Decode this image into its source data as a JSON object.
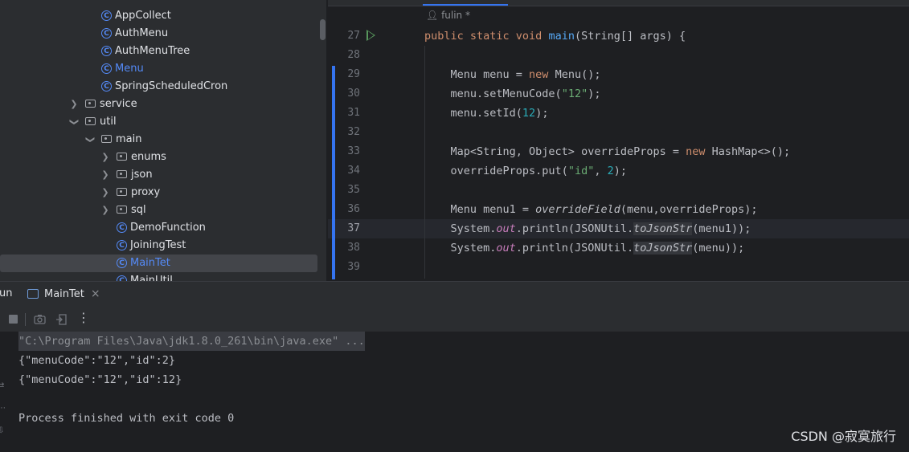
{
  "project_tree": {
    "items": [
      {
        "label": "AppCollect",
        "kind": "class"
      },
      {
        "label": "AuthMenu",
        "kind": "class"
      },
      {
        "label": "AuthMenuTree",
        "kind": "class"
      },
      {
        "label": "Menu",
        "kind": "class",
        "highlight": true
      },
      {
        "label": "SpringScheduledCron",
        "kind": "class"
      },
      {
        "label": "service",
        "kind": "folder",
        "expanded": false
      },
      {
        "label": "util",
        "kind": "folder",
        "expanded": true
      },
      {
        "label": "main",
        "kind": "folder",
        "expanded": true
      },
      {
        "label": "enums",
        "kind": "folder",
        "expanded": false
      },
      {
        "label": "json",
        "kind": "folder",
        "expanded": false
      },
      {
        "label": "proxy",
        "kind": "folder",
        "expanded": false
      },
      {
        "label": "sql",
        "kind": "folder",
        "expanded": false
      },
      {
        "label": "DemoFunction",
        "kind": "class"
      },
      {
        "label": "JoiningTest",
        "kind": "class"
      },
      {
        "label": "MainTet",
        "kind": "class",
        "selected": true
      },
      {
        "label": "MainUtil",
        "kind": "class"
      }
    ],
    "class_icon_letter": "C"
  },
  "editor": {
    "author_hint": "fulin *",
    "author_icon": "person-icon",
    "lines": [
      {
        "number": "27",
        "tokens": [
          [
            "kw",
            "public static void "
          ],
          [
            "fn",
            "main"
          ],
          [
            "",
            "(String[] args) {"
          ]
        ]
      },
      {
        "number": "28",
        "tokens": []
      },
      {
        "number": "29",
        "tokens": [
          [
            "",
            "    Menu menu = "
          ],
          [
            "kw",
            "new "
          ],
          [
            "",
            "Menu();"
          ]
        ]
      },
      {
        "number": "30",
        "tokens": [
          [
            "",
            "    menu.setMenuCode("
          ],
          [
            "str",
            "\"12\""
          ],
          [
            "",
            ");"
          ]
        ]
      },
      {
        "number": "31",
        "tokens": [
          [
            "",
            "    menu.setId("
          ],
          [
            "num",
            "12"
          ],
          [
            "",
            ");"
          ]
        ]
      },
      {
        "number": "32",
        "tokens": []
      },
      {
        "number": "33",
        "tokens": [
          [
            "",
            "    Map<String, Object> overrideProps = "
          ],
          [
            "kw",
            "new "
          ],
          [
            "",
            "HashMap<>();"
          ]
        ]
      },
      {
        "number": "34",
        "tokens": [
          [
            "",
            "    overrideProps.put("
          ],
          [
            "str",
            "\"id\""
          ],
          [
            "",
            ", "
          ],
          [
            "num",
            "2"
          ],
          [
            "",
            ");"
          ]
        ]
      },
      {
        "number": "35",
        "tokens": []
      },
      {
        "number": "36",
        "tokens": [
          [
            "",
            "    Menu menu1 = "
          ],
          [
            "ifn",
            "overrideField"
          ],
          [
            "",
            "(menu,overrideProps);"
          ]
        ]
      },
      {
        "number": "37",
        "tokens": [
          [
            "",
            "    System."
          ],
          [
            "stat",
            "out"
          ],
          [
            "",
            ".println(JSONUtil."
          ],
          [
            "sfn",
            "toJsonStr"
          ],
          [
            "",
            "(menu1));"
          ]
        ],
        "current": true
      },
      {
        "number": "38",
        "tokens": [
          [
            "",
            "    System."
          ],
          [
            "stat",
            "out"
          ],
          [
            "",
            ".println(JSONUtil."
          ],
          [
            "sfn",
            "toJsonStr"
          ],
          [
            "",
            "(menu));"
          ]
        ]
      },
      {
        "number": "39",
        "tokens": []
      }
    ]
  },
  "run_panel": {
    "title_fragment": "un",
    "tab_label": "MainTet",
    "close_glyph": "×",
    "toolbar_glyphs": {
      "more": "⋮"
    },
    "console_lines": [
      "\"C:\\Program Files\\Java\\jdk1.8.0_261\\bin\\java.exe\" ...",
      "{\"menuCode\":\"12\",\"id\":2}",
      "{\"menuCode\":\"12\",\"id\":12}",
      "",
      "Process finished with exit code 0"
    ],
    "left_strip_glyphs": [
      "⇄",
      "⋯",
      "⇩"
    ]
  },
  "watermark": "CSDN @寂寞旅行",
  "colors": {
    "accent": "#3574f0",
    "keyword": "#cf8e6d",
    "string": "#6aab73",
    "number": "#2aacb8",
    "method": "#56a8f5",
    "static_field": "#c77dbb",
    "run_green": "#57965c"
  }
}
